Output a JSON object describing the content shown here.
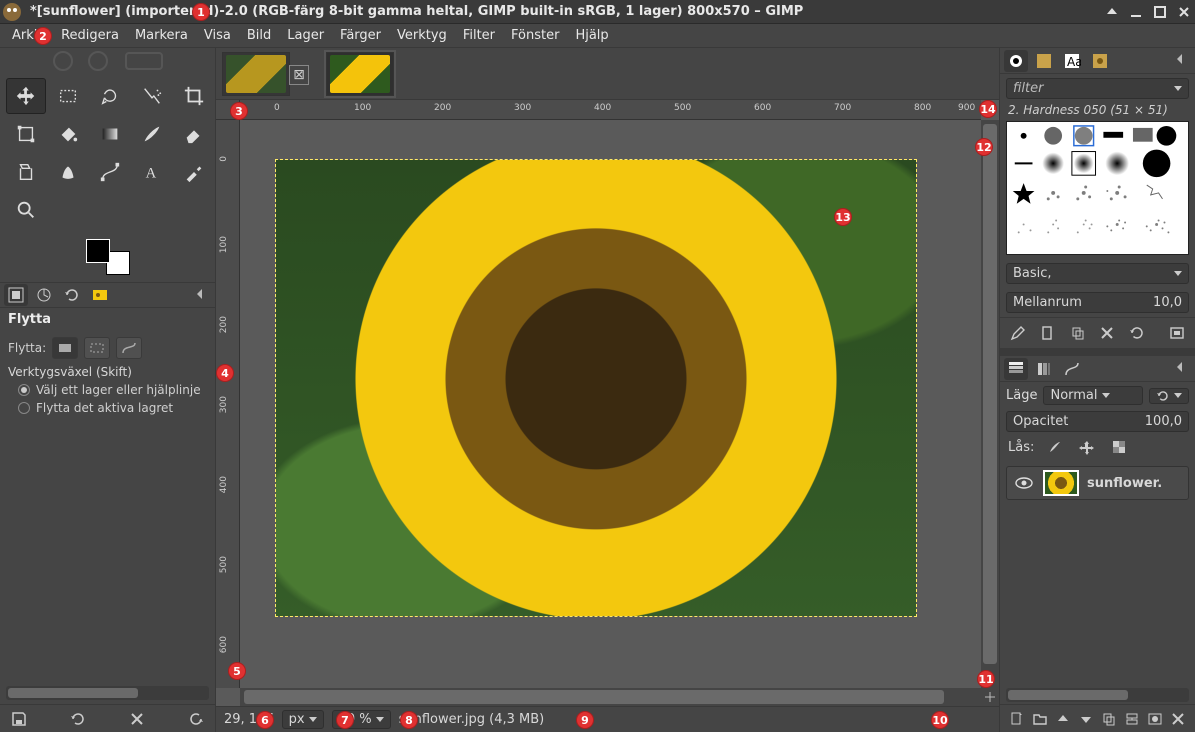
{
  "title": "*[sunflower] (importerad)-2.0 (RGB-färg 8-bit gamma heltal, GIMP built-in sRGB, 1 lager) 800x570 – GIMP",
  "menu": [
    "Arkiv",
    "Redigera",
    "Markera",
    "Visa",
    "Bild",
    "Lager",
    "Färger",
    "Verktyg",
    "Filter",
    "Fönster",
    "Hjälp"
  ],
  "tool_options": {
    "title": "Flytta",
    "move_label": "Flytta:",
    "section": "Verktygsväxel  (Skift)",
    "radio1": "Välj ett lager eller hjälplinje",
    "radio2": "Flytta det aktiva lagret"
  },
  "status": {
    "coords": "29, 197",
    "unit": "px",
    "zoom": "80 %",
    "file_info": "sunflower.jpg (4,3  MB)"
  },
  "brushes": {
    "filter_placeholder": "filter",
    "caption": "2. Hardness 050 (51 × 51)",
    "preset_label": "Basic,",
    "spacing_label": "Mellanrum",
    "spacing_value": "10,0"
  },
  "layers": {
    "mode_label": "Läge",
    "mode_value": "Normal",
    "opacity_label": "Opacitet",
    "opacity_value": "100,0",
    "lock_label": "Lås:",
    "layer_name": "sunflower."
  },
  "ruler_h_labels": [
    "0",
    "100",
    "200",
    "300",
    "400",
    "500",
    "600",
    "700",
    "800",
    "900"
  ],
  "ruler_v_labels": [
    "0",
    "100",
    "200",
    "300",
    "400",
    "500",
    "600"
  ],
  "callouts": {
    "1": "1",
    "2": "2",
    "3": "3",
    "4": "4",
    "5": "5",
    "6": "6",
    "7": "7",
    "8": "8",
    "9": "9",
    "10": "10",
    "11": "11",
    "12": "12",
    "13": "13",
    "14": "14"
  }
}
